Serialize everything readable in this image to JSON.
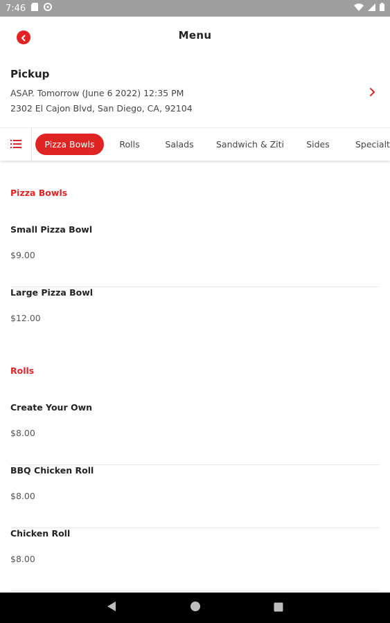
{
  "status_bar": {
    "time": "7:46",
    "icons": [
      "sd-card-icon",
      "data-saver-icon",
      "wifi-icon",
      "signal-icon",
      "battery-icon"
    ]
  },
  "header": {
    "title": "Menu",
    "back_icon": "back-arrow-icon"
  },
  "pickup": {
    "title": "Pickup",
    "time": "ASAP. Tomorrow (June 6 2022) 12:35 PM",
    "address": "2302 El Cajon Blvd, San Diego, CA, 92104",
    "icon": "chevron-right-icon"
  },
  "tabs": {
    "list_icon": "list-icon",
    "items": [
      {
        "label": "Pizza Bowls"
      },
      {
        "label": "Rolls"
      },
      {
        "label": "Salads"
      },
      {
        "label": "Sandwich & Ziti"
      },
      {
        "label": "Sides"
      },
      {
        "label": "Specialty"
      }
    ],
    "selected": "Pizza Bowls"
  },
  "sections": [
    {
      "title": "Pizza Bowls",
      "items": [
        {
          "name": "Small Pizza Bowl",
          "price": "$9.00"
        },
        {
          "name": "Large Pizza Bowl",
          "price": "$12.00"
        }
      ]
    },
    {
      "title": "Rolls",
      "items": [
        {
          "name": "Create Your Own",
          "price": "$8.00"
        },
        {
          "name": "BBQ Chicken Roll",
          "price": "$8.00"
        },
        {
          "name": "Chicken Roll",
          "price": "$8.00"
        }
      ]
    }
  ],
  "nav_bar": {
    "buttons": [
      "back-triangle-icon",
      "home-circle-icon",
      "recents-square-icon"
    ]
  },
  "colors": {
    "accent": "#e02424",
    "status_bar": "#9e9e9e",
    "nav_bar": "#000000"
  }
}
